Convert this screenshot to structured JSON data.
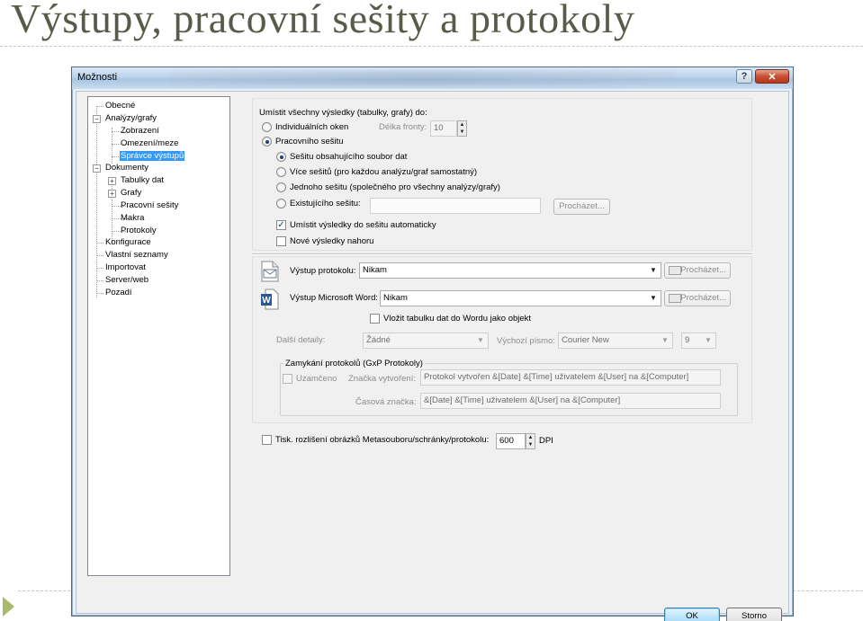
{
  "slide": {
    "title": "Výstupy, pracovní sešity a protokoly"
  },
  "dialog": {
    "title": "Možnosti",
    "help_glyph": "?",
    "close_glyph": "✕",
    "ok_label": "OK",
    "cancel_label": "Storno"
  },
  "tree": {
    "items": [
      {
        "label": "Obecné"
      },
      {
        "label": "Analýzy/grafy"
      },
      {
        "label": "Zobrazení"
      },
      {
        "label": "Omezení/meze"
      },
      {
        "label": "Správce výstupů"
      },
      {
        "label": "Dokumenty"
      },
      {
        "label": "Tabulky dat"
      },
      {
        "label": "Grafy"
      },
      {
        "label": "Pracovní sešity"
      },
      {
        "label": "Makra"
      },
      {
        "label": "Protokoly"
      },
      {
        "label": "Konfigurace"
      },
      {
        "label": "Vlastní seznamy"
      },
      {
        "label": "Importovat"
      },
      {
        "label": "Server/web"
      },
      {
        "label": "Pozadí"
      }
    ],
    "selected": "Správce výstupů",
    "expander_minus": "−",
    "expander_plus": "+"
  },
  "placement": {
    "heading": "Umístit všechny výsledky (tabulky, grafy) do:",
    "individual_windows": "Individuálních oken",
    "queue_length_label": "Délka fronty:",
    "queue_length_value": "10",
    "workbook": "Pracovního sešitu",
    "containing_workbook": "Sešitu obsahujícího soubor dat",
    "multiple_workbooks": "Více sešitů (pro každou analýzu/graf samostatný)",
    "single_workbook": "Jednoho sešitu (společného pro všechny analýzy/grafy)",
    "existing_workbook": "Existujícího sešitu:",
    "existing_workbook_value": "",
    "browse": "Procházet...",
    "auto_place": "Umístit výsledky do sešitu automaticky",
    "new_results_top": "Nové výsledky nahoru"
  },
  "output": {
    "report_output_label": "Výstup protokolu:",
    "report_output_value": "Nikam",
    "word_output_label": "Výstup Microsoft Word:",
    "word_output_value": "Nikam",
    "browse": "Procházet...",
    "insert_table": "Vložit tabulku dat do Wordu jako objekt",
    "more_details_label": "Další detaily:",
    "more_details_value": "Žádné",
    "default_font_label": "Výchozí písmo:",
    "default_font_value": "Courier New",
    "font_size_value": "9"
  },
  "locking": {
    "group_title": "Zamykání protokolů (GxP Protokoly)",
    "locked": "Uzamčeno",
    "creation_tag_label": "Značka vytvoření:",
    "creation_tag_value": "Protokol vytvořen &[Date] &[Time] uživatelem &[User] na &[Computer]",
    "time_tag_label": "Časová značka:",
    "time_tag_value": "&[Date] &[Time] uživatelem &[User] na &[Computer]"
  },
  "print_resolution": {
    "label": "Tisk. rozlišení obrázků Metasouboru/schránky/protokolu:",
    "value": "600",
    "unit": "DPI"
  },
  "icons": {
    "checkmark": "✓",
    "combo_arrow": "▼",
    "spin_up": "▲",
    "spin_down": "▼",
    "word_letter": "W"
  },
  "colors": {
    "selection": "#3399ff",
    "close_button": "#c84f31",
    "title_text": "#5a5a4a",
    "accent_arrow": "#a9b96b"
  }
}
